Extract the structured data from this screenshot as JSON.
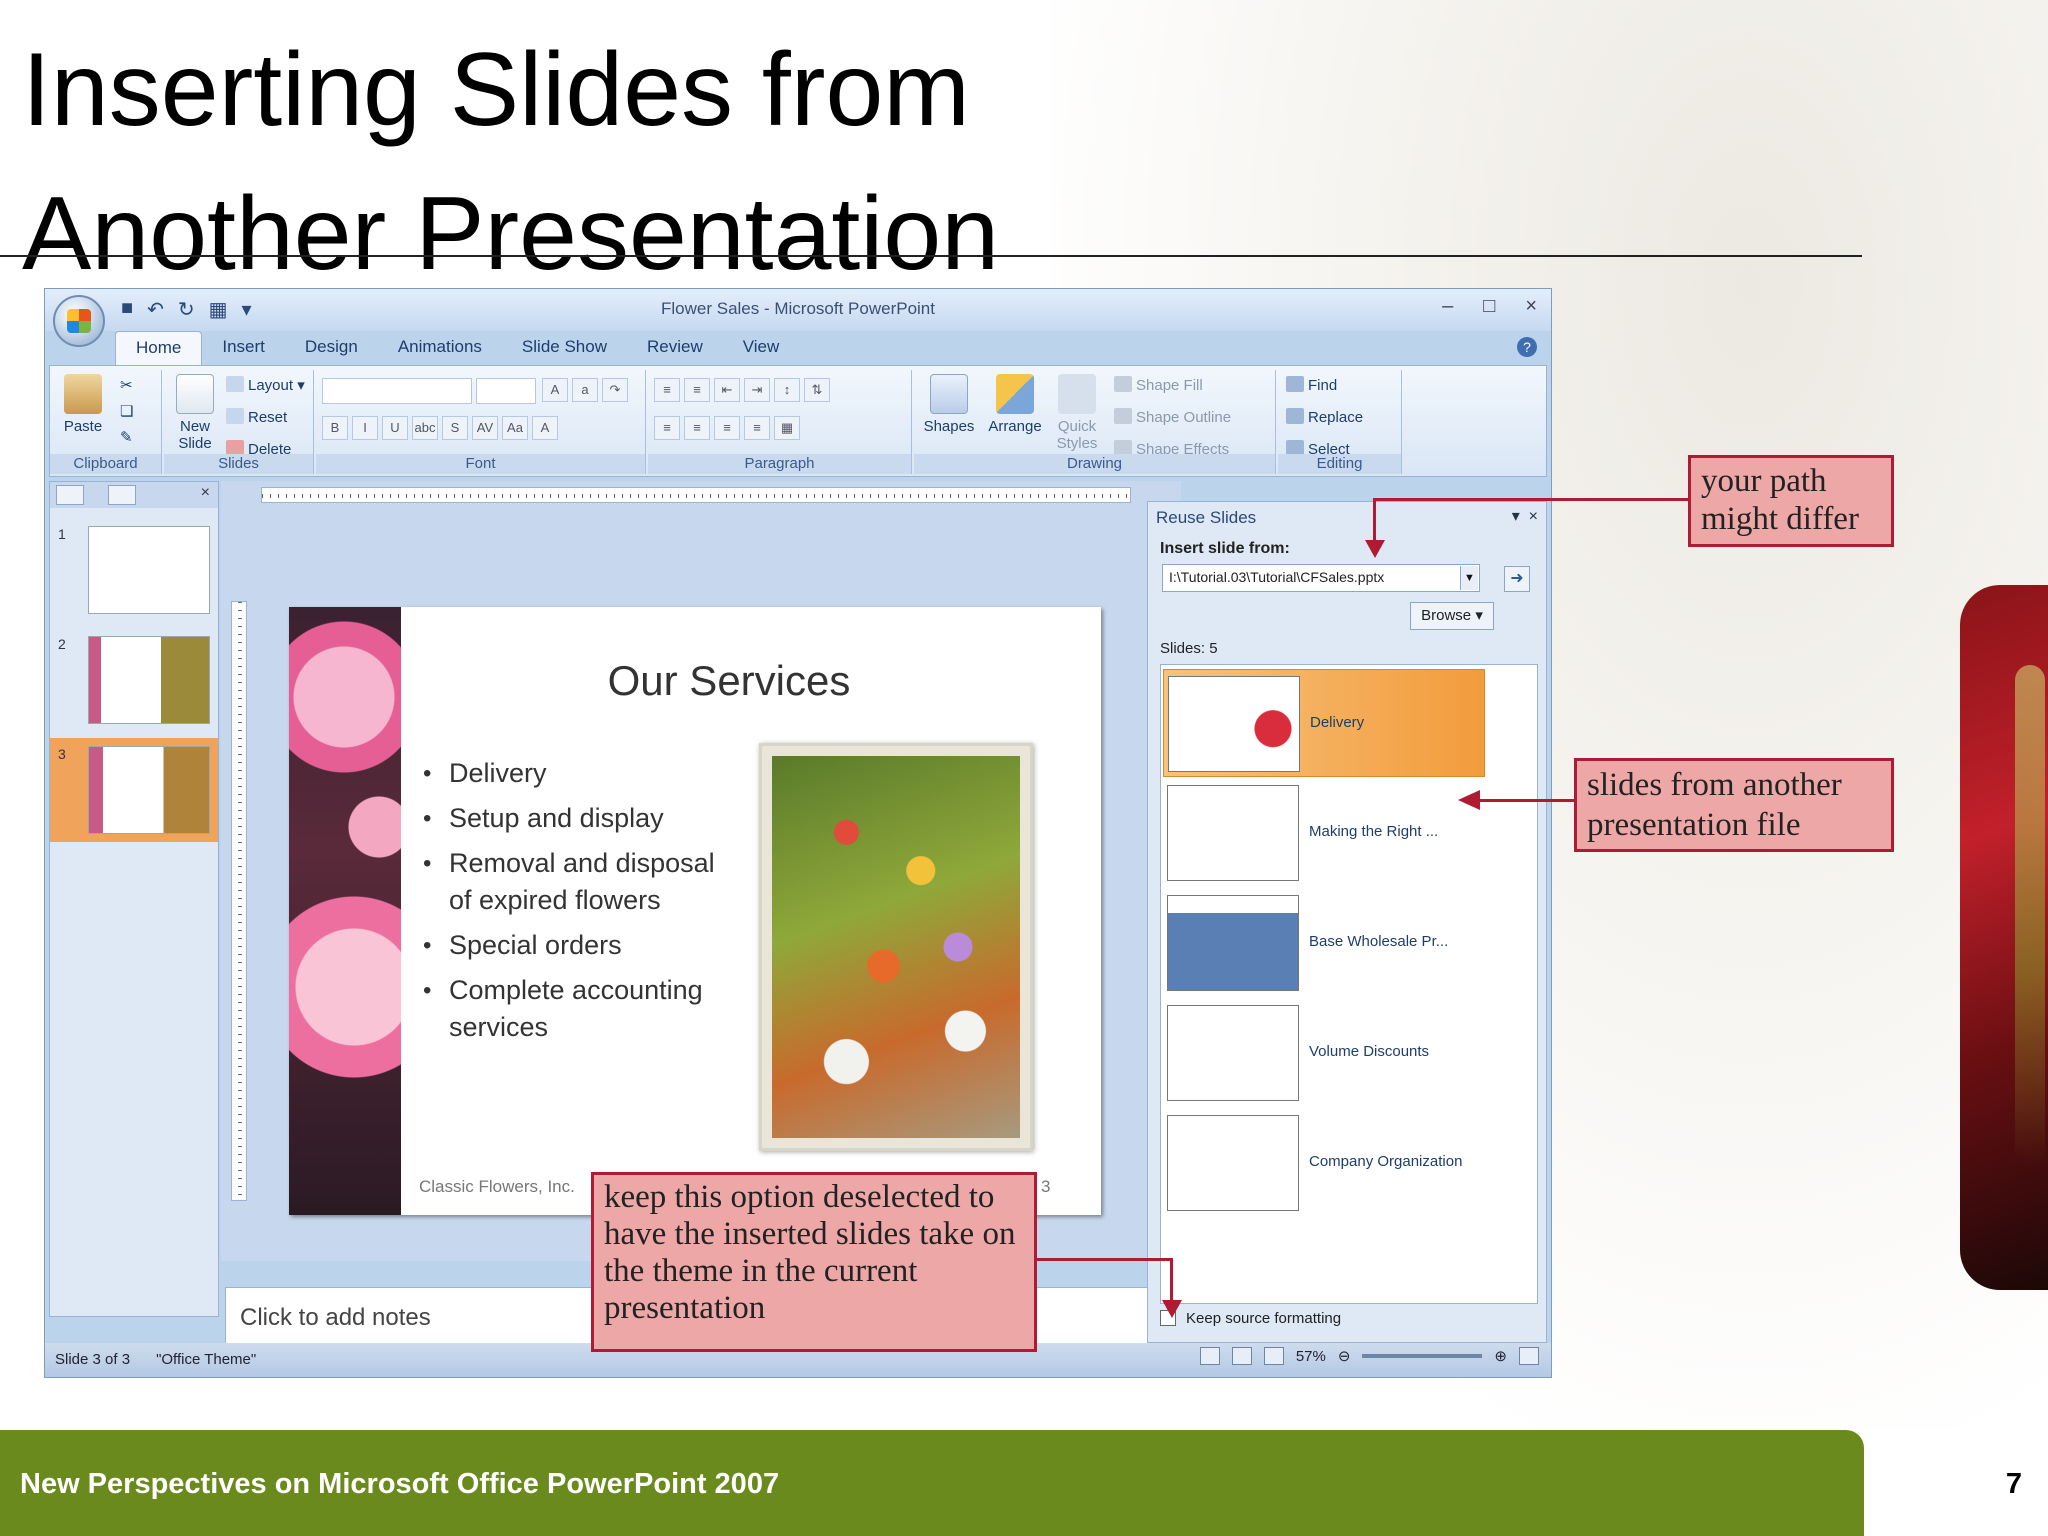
{
  "slide_title": {
    "line1": "Inserting Slides from",
    "line2": "Another Presentation"
  },
  "footer": {
    "text": "New Perspectives on Microsoft Office PowerPoint 2007",
    "page_number": "7"
  },
  "window": {
    "title": "Flower Sales - Microsoft PowerPoint",
    "tabs": [
      "Home",
      "Insert",
      "Design",
      "Animations",
      "Slide Show",
      "Review",
      "View"
    ],
    "active_tab": "Home"
  },
  "ribbon": {
    "clipboard": {
      "label": "Clipboard",
      "paste": "Paste"
    },
    "slides": {
      "label": "Slides",
      "new_slide": "New Slide",
      "layout": "Layout",
      "reset": "Reset",
      "delete": "Delete"
    },
    "font": {
      "label": "Font"
    },
    "paragraph": {
      "label": "Paragraph"
    },
    "drawing": {
      "label": "Drawing",
      "shapes": "Shapes",
      "arrange": "Arrange",
      "quick_styles": "Quick Styles",
      "shape_fill": "Shape Fill",
      "shape_outline": "Shape Outline",
      "shape_effects": "Shape Effects"
    },
    "editing": {
      "label": "Editing",
      "find": "Find",
      "replace": "Replace",
      "select": "Select"
    }
  },
  "thumbnails": {
    "numbers": [
      "1",
      "2",
      "3"
    ],
    "selected": "3"
  },
  "current_slide": {
    "title": "Our Services",
    "bullets": [
      "Delivery",
      "Setup and display",
      "Removal and disposal of expired flowers",
      "Special orders",
      "Complete accounting services"
    ],
    "footer": "Classic Flowers, Inc.",
    "page": "3"
  },
  "notes_placeholder": "Click to add notes",
  "reuse_pane": {
    "title": "Reuse Slides",
    "insert_from_label": "Insert slide from:",
    "path": "I:\\Tutorial.03\\Tutorial\\CFSales.pptx",
    "browse": "Browse",
    "slides_count": "Slides: 5",
    "slides": [
      "Delivery",
      "Making the Right ...",
      "Base Wholesale Pr...",
      "Volume Discounts",
      "Company Organization"
    ],
    "selected": "Delivery",
    "keep_source": "Keep source formatting"
  },
  "status_bar": {
    "slide_info": "Slide 3 of 3",
    "theme": "\"Office Theme\"",
    "zoom": "57%"
  },
  "callouts": {
    "path": "your path might differ",
    "slides_file": "slides from another presentation file",
    "keep_option": "keep this option deselected to have the inserted slides take on the theme in the current presentation"
  },
  "colors": {
    "footer_bar": "#6a8a1e",
    "callout_fill": "#eda7a6",
    "callout_border": "#b01b34"
  }
}
